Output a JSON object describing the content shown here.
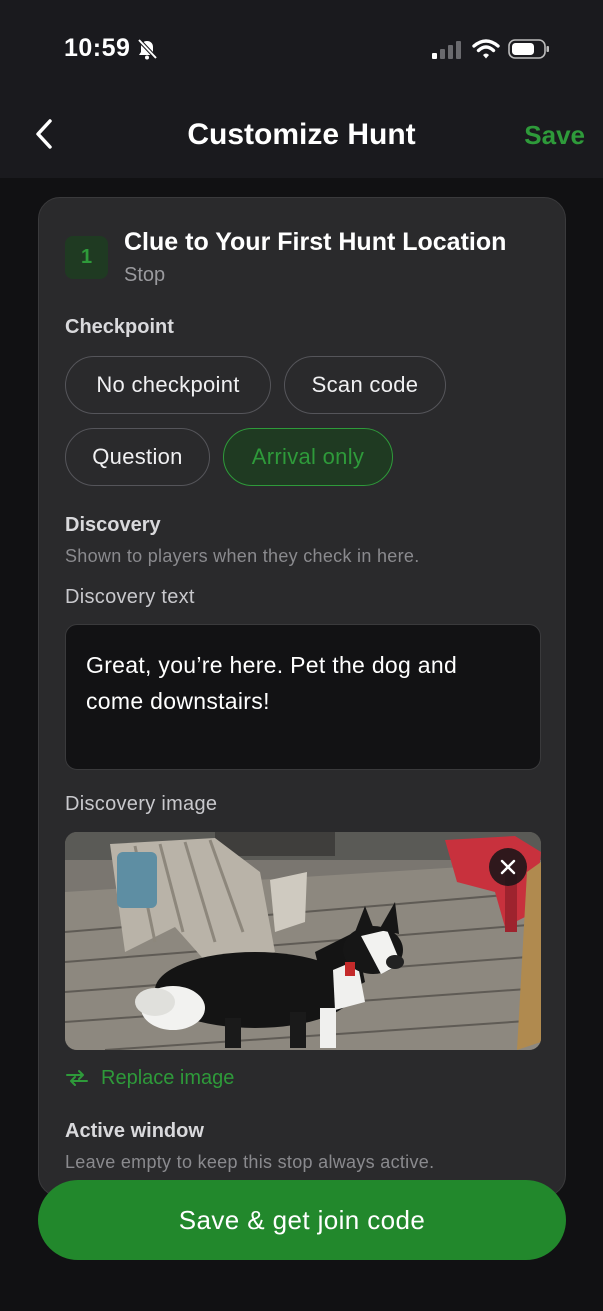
{
  "status_bar": {
    "time": "10:59",
    "icons": [
      "bell-slash-icon",
      "cellular-signal-icon",
      "wifi-icon",
      "battery-icon"
    ]
  },
  "nav": {
    "title": "Customize Hunt",
    "save_label": "Save",
    "back_icon": "chevron-left-icon"
  },
  "stop": {
    "number": "1",
    "title": "Clue to Your First Hunt Location",
    "subtitle": "Stop"
  },
  "checkpoint": {
    "label": "Checkpoint",
    "options": [
      "No checkpoint",
      "Scan code",
      "Question",
      "Arrival only"
    ],
    "selected": "Arrival only"
  },
  "discovery": {
    "heading": "Discovery",
    "helper": "Shown to players when they check in here.",
    "text_label": "Discovery text",
    "text_value": "Great, you’re here.  Pet the dog and come downstairs!",
    "image_label": "Discovery image",
    "replace_label": "Replace image"
  },
  "active_window": {
    "heading": "Active window",
    "helper": "Leave empty to keep this stop always active."
  },
  "primary_action": {
    "label": "Save & get join code"
  },
  "colors": {
    "accent": "#2e9a3a",
    "button": "#22882c",
    "background": "#111113",
    "card": "#2a2a2c"
  }
}
